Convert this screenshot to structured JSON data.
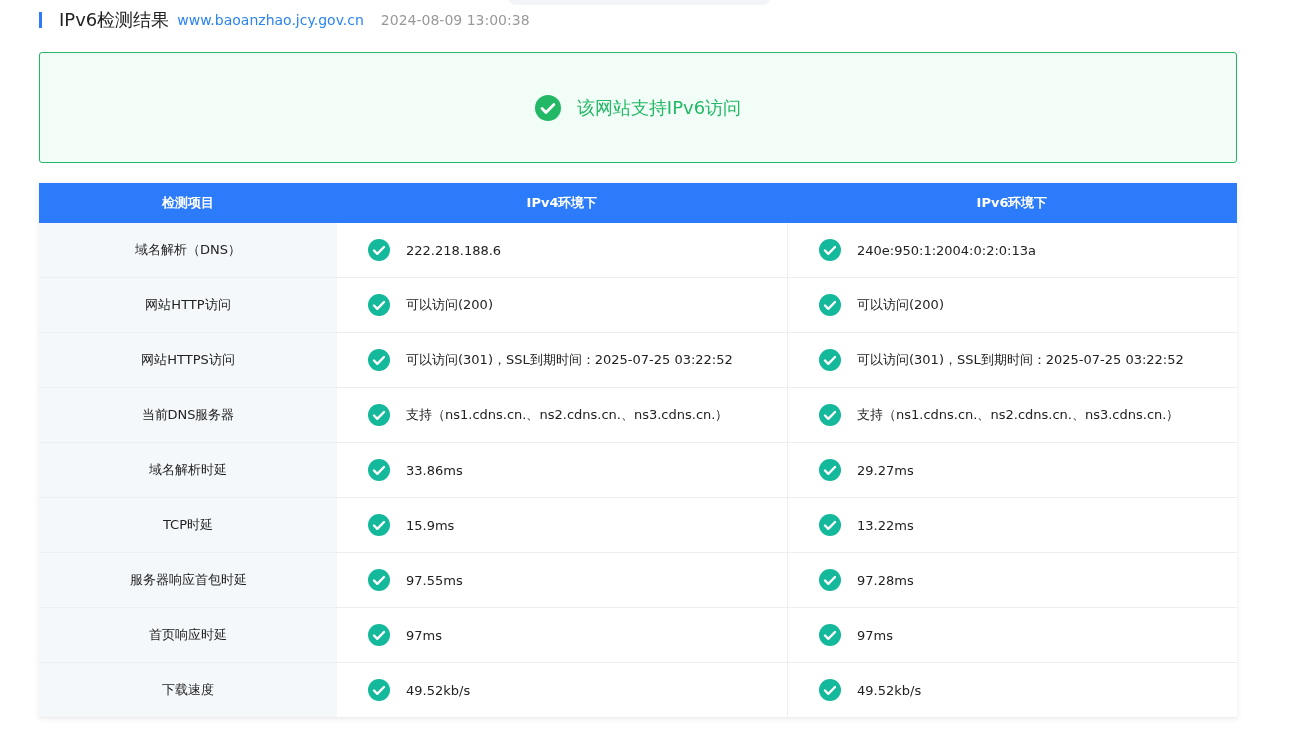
{
  "header": {
    "title": "IPv6检测结果",
    "domain": "www.baoanzhao.jcy.gov.cn",
    "time": "2024-08-09 13:00:38"
  },
  "result": {
    "supported": true,
    "message": "该网站支持IPv6访问"
  },
  "table": {
    "columns": [
      "检测项目",
      "IPv4环境下",
      "IPv6环境下"
    ],
    "rows": [
      {
        "item": "域名解析（DNS）",
        "cells": [
          {
            "ok": true,
            "text": "222.218.188.6"
          },
          {
            "ok": true,
            "text": "240e:950:1:2004:0:2:0:13a"
          }
        ]
      },
      {
        "item": "网站HTTP访问",
        "cells": [
          {
            "ok": true,
            "text": "可以访问(200)"
          },
          {
            "ok": true,
            "text": "可以访问(200)"
          }
        ]
      },
      {
        "item": "网站HTTPS访问",
        "cells": [
          {
            "ok": true,
            "text": "可以访问(301)，SSL到期时间：2025-07-25 03:22:52"
          },
          {
            "ok": true,
            "text": "可以访问(301)，SSL到期时间：2025-07-25 03:22:52"
          }
        ]
      },
      {
        "item": "当前DNS服务器",
        "cells": [
          {
            "ok": true,
            "text": "支持（ns1.cdns.cn.、ns2.cdns.cn.、ns3.cdns.cn.）"
          },
          {
            "ok": true,
            "text": "支持（ns1.cdns.cn.、ns2.cdns.cn.、ns3.cdns.cn.）"
          }
        ]
      },
      {
        "item": "域名解析时延",
        "cells": [
          {
            "ok": true,
            "text": "33.86ms"
          },
          {
            "ok": true,
            "text": "29.27ms"
          }
        ]
      },
      {
        "item": "TCP时延",
        "cells": [
          {
            "ok": true,
            "text": "15.9ms"
          },
          {
            "ok": true,
            "text": "13.22ms"
          }
        ]
      },
      {
        "item": "服务器响应首包时延",
        "cells": [
          {
            "ok": true,
            "text": "97.55ms"
          },
          {
            "ok": true,
            "text": "97.28ms"
          }
        ]
      },
      {
        "item": "首页响应时延",
        "cells": [
          {
            "ok": true,
            "text": "97ms"
          },
          {
            "ok": true,
            "text": "97ms"
          }
        ]
      },
      {
        "item": "下载速度",
        "cells": [
          {
            "ok": true,
            "text": "49.52kb/s"
          },
          {
            "ok": true,
            "text": "49.52kb/s"
          }
        ]
      }
    ]
  }
}
